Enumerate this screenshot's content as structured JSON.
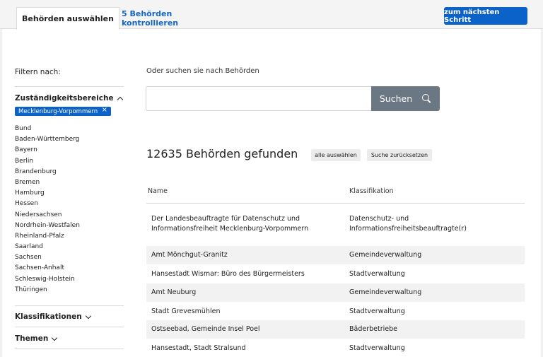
{
  "tabs": [
    {
      "label": "Behörden auswählen"
    },
    {
      "label": "5 Behörden kontrollieren"
    }
  ],
  "next_button": "zum nächsten Schritt",
  "sidebar": {
    "filter_title": "Filtern nach:",
    "sections": {
      "zustaendigkeit": "Zuständigkeitsbereiche",
      "klassifikationen": "Klassifikationen",
      "themen": "Themen"
    },
    "selected_chip": "Mecklenburg-Vorpommern",
    "states": [
      "Bund",
      "Baden-Württemberg",
      "Bayern",
      "Berlin",
      "Brandenburg",
      "Bremen",
      "Hamburg",
      "Hessen",
      "Niedersachsen",
      "Nordrhein-Westfalen",
      "Rheinland-Pfalz",
      "Saarland",
      "Sachsen",
      "Sachsen-Anhalt",
      "Schleswig-Holstein",
      "Thüringen"
    ]
  },
  "search": {
    "label": "Oder suchen sie nach Behörden",
    "value": "",
    "button": "Suchen"
  },
  "results": {
    "count_text": "12635 Behörden gefunden",
    "select_all": "alle auswählen",
    "reset": "Suche zurücksetzen",
    "columns": [
      "Name",
      "Klassifikation"
    ],
    "rows": [
      {
        "name": "Der Landesbeauftragte für Datenschutz und Informationsfreiheit Mecklenburg-Vorpommern",
        "class": "Datenschutz- und Informationsfreiheitsbeauftragte(r)"
      },
      {
        "name": "Amt Mönchgut-Granitz",
        "class": "Gemeindeverwaltung"
      },
      {
        "name": "Hansestadt Wismar: Büro des Bürgermeisters",
        "class": "Stadtverwaltung"
      },
      {
        "name": "Amt Neuburg",
        "class": "Gemeindeverwaltung"
      },
      {
        "name": "Stadt Grevesmühlen",
        "class": "Stadtverwaltung"
      },
      {
        "name": "Ostseebad, Gemeinde Insel Poel",
        "class": "Bäderbetriebe"
      },
      {
        "name": "Hansestadt, Stadt Stralsund",
        "class": "Stadtverwaltung"
      }
    ]
  }
}
